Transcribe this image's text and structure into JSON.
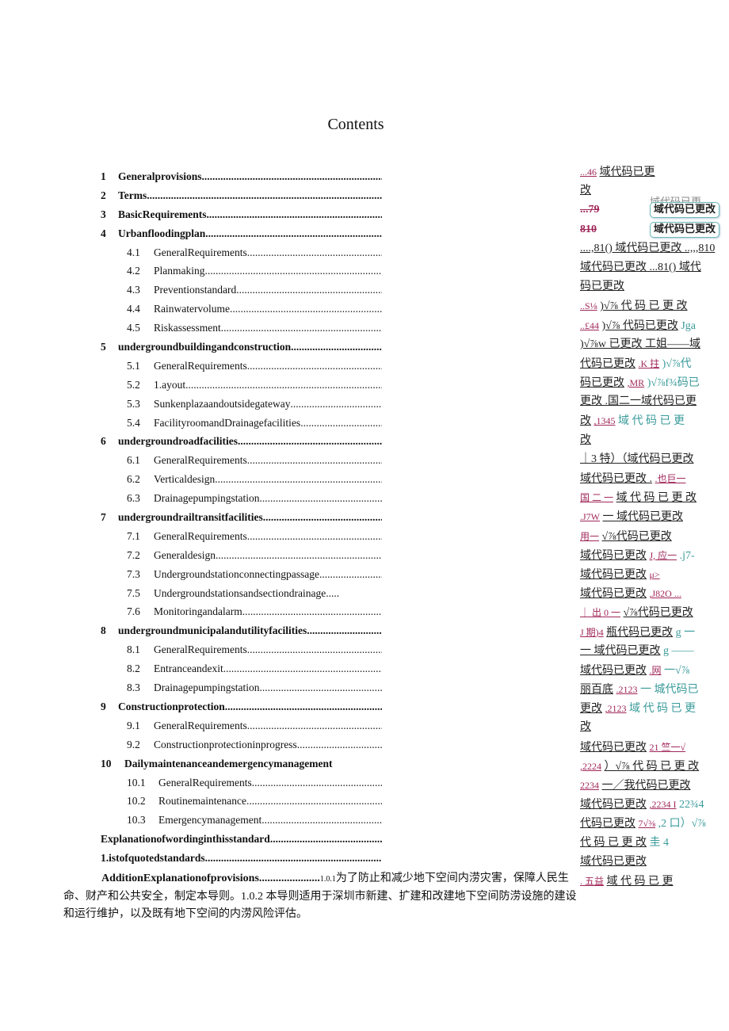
{
  "title": "Contents",
  "toc": [
    {
      "num": "1",
      "label": "Generalprovisions",
      "level": 1
    },
    {
      "num": "2",
      "label": "Terms",
      "level": 1
    },
    {
      "num": "3",
      "label": "BasicRequirements",
      "level": 1
    },
    {
      "num": "4",
      "label": "Urbanfloodingplan",
      "level": 1
    },
    {
      "num": "4.1",
      "label": "GeneralRequirements",
      "level": 2
    },
    {
      "num": "4.2",
      "label": "Planmaking",
      "level": 2
    },
    {
      "num": "4.3",
      "label": "Preventionstandard",
      "level": 2
    },
    {
      "num": "4.4",
      "label": "Rainwatervolume",
      "level": 2
    },
    {
      "num": "4.5",
      "label": "Riskassessment",
      "level": 2
    },
    {
      "num": "5",
      "label": "undergroundbuildingandconstruction",
      "level": 1
    },
    {
      "num": "5.1",
      "label": "GeneralRequirements",
      "level": 2
    },
    {
      "num": "5.2",
      "label": "1.ayout",
      "level": 2
    },
    {
      "num": "5.3",
      "label": "Sunkenplazaandoutsidegateway",
      "level": 2
    },
    {
      "num": "5.4",
      "label": "FacilityroomandDrainagefacilities",
      "level": 2
    },
    {
      "num": "6",
      "label": "undergroundroadfacilities",
      "level": 1
    },
    {
      "num": "6.1",
      "label": "GeneralRequirements",
      "level": 2
    },
    {
      "num": "6.2",
      "label": "Verticaldesign",
      "level": 2
    },
    {
      "num": "6.3",
      "label": "Drainagepumpingstation",
      "level": 2
    },
    {
      "num": "7",
      "label": "undergroundrailtransitfacilities",
      "level": 1
    },
    {
      "num": "7.1",
      "label": "GeneralRequirements",
      "level": 2
    },
    {
      "num": "7.2",
      "label": "Generaldesign",
      "level": 2
    },
    {
      "num": "7.3",
      "label": "Undergroundstationconnectingpassage",
      "level": 2
    },
    {
      "num": "7.5",
      "label": "Undergroundstationsandsectiondrainage.....",
      "level": 2,
      "nodots": true
    },
    {
      "num": "7.6",
      "label": "Monitoringandalarm",
      "level": 2
    },
    {
      "num": "8",
      "label": "undergroundmunicipalandutilityfacilities",
      "level": 1
    },
    {
      "num": "8.1",
      "label": "GeneralRequirements",
      "level": 2
    },
    {
      "num": "8.2",
      "label": "Entranceandexit",
      "level": 2
    },
    {
      "num": "8.3",
      "label": "Drainagepumpingstation",
      "level": 2
    },
    {
      "num": "9",
      "label": "Constructionprotection",
      "level": 1
    },
    {
      "num": "9.1",
      "label": "GeneralRequirements",
      "level": 2
    },
    {
      "num": "9.2",
      "label": "Constructionprotectioninprogress",
      "level": 2
    },
    {
      "num": "10",
      "label": "Dailymaintenanceandemergencymanagement",
      "level": 1,
      "nodots": true
    },
    {
      "num": "10.1",
      "label": "GeneralRequirements",
      "level": 2
    },
    {
      "num": "10.2",
      "label": "Routinemaintenance",
      "level": 2
    },
    {
      "num": "10.3",
      "label": "Emergencymanagement",
      "level": 2
    },
    {
      "num": "",
      "label": "Explanationofwordinginthisstandard",
      "level": 1
    },
    {
      "num": "",
      "label": "1.istofquotedstandards",
      "level": 1
    }
  ],
  "addition": {
    "lead": "AdditionExplanationofprovisions......................",
    "small_num": "1.0.1",
    "text": "为了防止和减少地下空间内涝灾害，保障人民生命、财产和公共安全，制定本导则。1.0.2 本导则适用于深圳市新建、扩建和改建地下空间防涝设施的建设和运行维护，以及既有地下空间的内涝风险评估。"
  },
  "annotations": {
    "changed_text": "域代码已更改",
    "lines": [
      {
        "pn": "...46",
        "text": "域代码已更"
      },
      {
        "text": "改"
      },
      {
        "pn": "...79",
        "bubble": "域代码已更改",
        "ghost": "域代码已更"
      },
      {
        "pn": "810",
        "bubble": "域代码已更改"
      },
      {
        "text": "....,81() 域代码已更改 ..,,,810"
      },
      {
        "text": "域代码已更改 ...81() 域代"
      },
      {
        "text": "码已更改"
      },
      {
        "pn": "..S⅛",
        "text": ")√⅞ 代 码 已 更 改"
      },
      {
        "pn": "..£44",
        "text": ")√⅞ 代码已更改",
        "tail": "Jga"
      },
      {
        "text": ")√⅞w 已更改 工姐——域"
      },
      {
        "text": "代码已更改",
        "pn": ".K 拄",
        "tail": ")√⅞代"
      },
      {
        "text": "码已更改",
        "pn": ",MR",
        "tail": ")√⅞f¾码已"
      },
      {
        "text": "更改 .国二一域代码已更"
      },
      {
        "text": "改",
        "pn": ",1345",
        "tail": "域 代 码 已 更"
      },
      {
        "text": "改"
      },
      {
        "text": "｜3 特）（域代码已更改"
      },
      {
        "pn": ".也巨一",
        "text": "域代码已更改 ."
      },
      {
        "pn": "国 二 一",
        "text": "域 代 码 已 更 改"
      },
      {
        "pn": ".J7W",
        "text": "一 域代码已更改"
      },
      {
        "pn": "用一",
        "text": "√⅞代码已更改"
      },
      {
        "pn": "J, 应一",
        "text": "域代码已更改",
        "tail": ".j7-"
      },
      {
        "pn": "μ>",
        "text": "域代码已更改"
      },
      {
        "pn": ",J82O ...",
        "text": "域代码已更改"
      },
      {
        "pn": "｜ 出 0 一",
        "text": "√⅞代码已更改"
      },
      {
        "pn": "J 期)4",
        "text": "瓶代码已更改",
        "tail": "g 一"
      },
      {
        "text": "一 域代码已更改",
        "tail": "g ——"
      },
      {
        "text": "域代码已更改",
        "pn": ".网",
        "tail": "一√⅞"
      },
      {
        "text": "丽百底",
        "pn": ".2123",
        "tail": "一 城代码已"
      },
      {
        "text": "更改",
        "pn": ",2123",
        "tail": "域 代 码 已 更"
      },
      {
        "text": "改"
      },
      {
        "pn": "21 竺一√",
        "text": "域代码已更改"
      },
      {
        "pn": ",2224",
        "text": "）√⅞ 代 码 已 更 改"
      },
      {
        "pn": "2234",
        "text": "一／我代码已更改"
      },
      {
        "pn": ",2234 I",
        "text": "域代码已更改",
        "tail": "22¾4"
      },
      {
        "pn": "7√⅜",
        "text": "代码已更改",
        "tail": ",2 口）√⅞"
      },
      {
        "text": "代 码 已 更 改",
        "tail": "圭 4"
      },
      {
        "text": "域代码已更改"
      },
      {
        "pn": ". 五益",
        "text": "域 代 码 已 更"
      }
    ]
  }
}
